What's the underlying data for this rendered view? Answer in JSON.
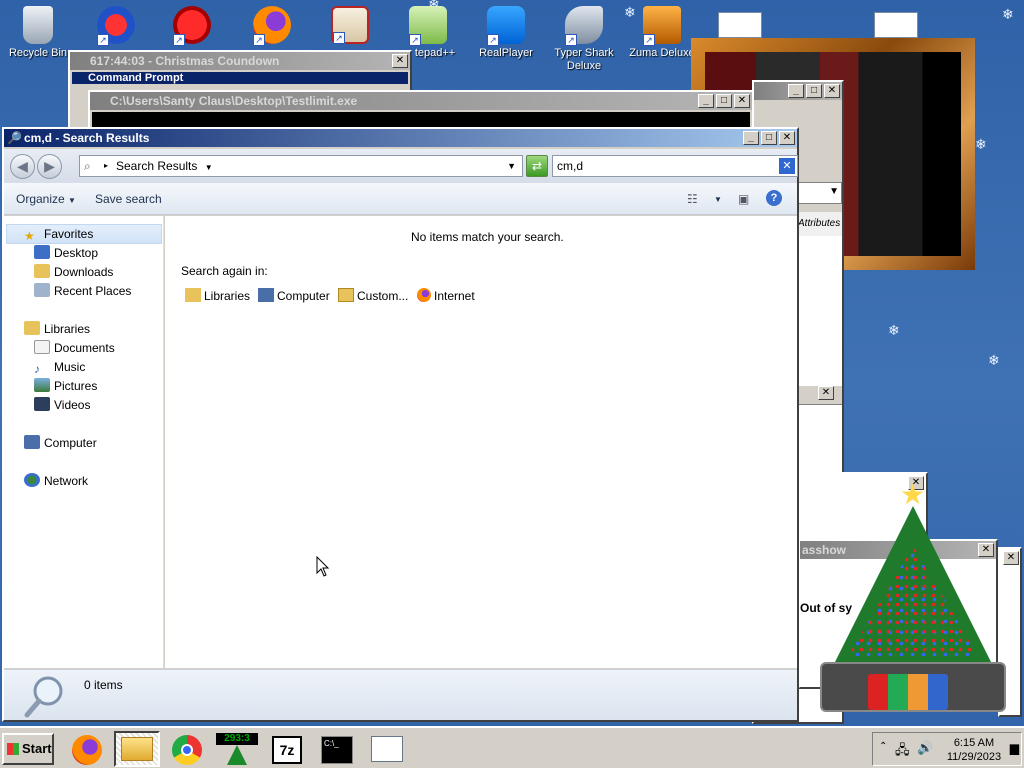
{
  "desktop": {
    "icons": [
      {
        "label": "Recycle Bin"
      },
      {
        "label": ""
      },
      {
        "label": ""
      },
      {
        "label": ""
      },
      {
        "label": ""
      },
      {
        "label": "tepad++"
      },
      {
        "label": "RealPlayer"
      },
      {
        "label": "Typer Shark Deluxe"
      },
      {
        "label": "Zuma Deluxe"
      }
    ]
  },
  "background_windows": {
    "countdown_title": "617:44:03 - Christmas Coundown",
    "cmd_title": "Command Prompt",
    "testlimit_title": "C:\\Users\\Santy Claus\\Desktop\\Testlimit.exe",
    "slideshow_title": "asshow",
    "out_of_sync_text": "Out of sy",
    "attributes_text": "Attributes"
  },
  "explorer": {
    "title": "cm,d - Search Results",
    "address": "Search Results",
    "search_value": "cm,d",
    "toolbar": {
      "organize": "Organize",
      "save_search": "Save search"
    },
    "nav": {
      "favorites": "Favorites",
      "desktop": "Desktop",
      "downloads": "Downloads",
      "recent": "Recent Places",
      "libraries": "Libraries",
      "documents": "Documents",
      "music": "Music",
      "pictures": "Pictures",
      "videos": "Videos",
      "computer": "Computer",
      "network": "Network"
    },
    "content": {
      "no_items": "No items match your search.",
      "search_again": "Search again in:",
      "locations": {
        "libraries": "Libraries",
        "computer": "Computer",
        "custom": "Custom...",
        "internet": "Internet"
      }
    },
    "status": "0 items"
  },
  "taskbar": {
    "start": "Start",
    "counter": "293:3",
    "sevenzip": "7z",
    "time": "6:15 AM",
    "date": "11/29/2023"
  },
  "colors": {
    "desktop_bg": "#3a6ea5",
    "active_title": "#0a246a",
    "inactive_title": "#808080"
  }
}
